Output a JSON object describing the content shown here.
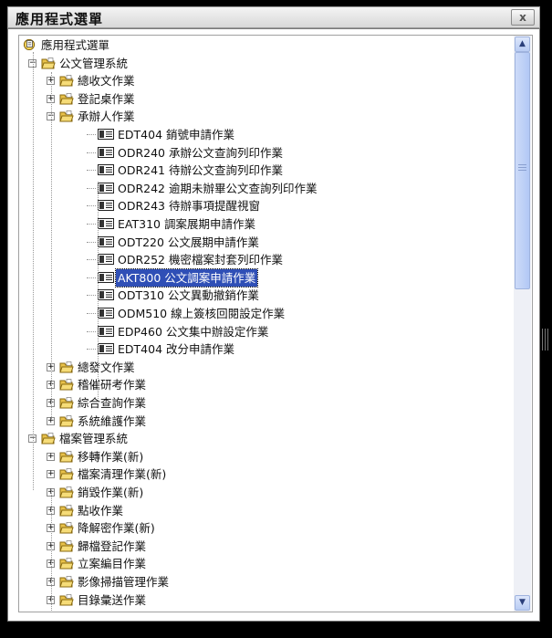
{
  "window": {
    "title": "應用程式選單",
    "close_label": "x"
  },
  "tree": {
    "root_label": "應用程式選單",
    "nodes": [
      {
        "label": "公文管理系統",
        "level": 1,
        "type": "folder",
        "expanded": true
      },
      {
        "label": "總收文作業",
        "level": 2,
        "type": "folder",
        "expanded": false
      },
      {
        "label": "登記桌作業",
        "level": 2,
        "type": "folder",
        "expanded": false
      },
      {
        "label": "承辦人作業",
        "level": 2,
        "type": "folder",
        "expanded": true
      },
      {
        "label": "EDT404 銷號申請作業",
        "level": 3,
        "type": "doc"
      },
      {
        "label": "ODR240 承辦公文查詢列印作業",
        "level": 3,
        "type": "doc"
      },
      {
        "label": "ODR241 待辦公文查詢列印作業",
        "level": 3,
        "type": "doc"
      },
      {
        "label": "ODR242 逾期未辦畢公文查詢列印作業",
        "level": 3,
        "type": "doc"
      },
      {
        "label": "ODR243 待辦事項提醒視窗",
        "level": 3,
        "type": "doc"
      },
      {
        "label": "EAT310 調案展期申請作業",
        "level": 3,
        "type": "doc"
      },
      {
        "label": "ODT220 公文展期申請作業",
        "level": 3,
        "type": "doc"
      },
      {
        "label": "ODR252 機密檔案封套列印作業",
        "level": 3,
        "type": "doc"
      },
      {
        "label": "AKT800 公文調案申請作業",
        "level": 3,
        "type": "doc",
        "selected": true
      },
      {
        "label": "ODT310 公文異動撤銷作業",
        "level": 3,
        "type": "doc"
      },
      {
        "label": "ODM510 線上簽核回閱設定作業",
        "level": 3,
        "type": "doc"
      },
      {
        "label": "EDP460 公文集中辦設定作業",
        "level": 3,
        "type": "doc"
      },
      {
        "label": "EDT404 改分申請作業",
        "level": 3,
        "type": "doc"
      },
      {
        "label": "總發文作業",
        "level": 2,
        "type": "folder",
        "expanded": false
      },
      {
        "label": "稽催研考作業",
        "level": 2,
        "type": "folder",
        "expanded": false
      },
      {
        "label": "綜合查詢作業",
        "level": 2,
        "type": "folder",
        "expanded": false
      },
      {
        "label": "系統維護作業",
        "level": 2,
        "type": "folder",
        "expanded": false
      },
      {
        "label": "檔案管理系統",
        "level": 1,
        "type": "folder",
        "expanded": true
      },
      {
        "label": "移轉作業(新)",
        "level": 2,
        "type": "folder",
        "expanded": false
      },
      {
        "label": "檔案清理作業(新)",
        "level": 2,
        "type": "folder",
        "expanded": false
      },
      {
        "label": "銷毀作業(新)",
        "level": 2,
        "type": "folder",
        "expanded": false
      },
      {
        "label": "點收作業",
        "level": 2,
        "type": "folder",
        "expanded": false
      },
      {
        "label": "降解密作業(新)",
        "level": 2,
        "type": "folder",
        "expanded": false
      },
      {
        "label": "歸檔登記作業",
        "level": 2,
        "type": "folder",
        "expanded": false
      },
      {
        "label": "立案編目作業",
        "level": 2,
        "type": "folder",
        "expanded": false
      },
      {
        "label": "影像掃描管理作業",
        "level": 2,
        "type": "folder",
        "expanded": false
      },
      {
        "label": "目錄彙送作業",
        "level": 2,
        "type": "folder",
        "expanded": false
      }
    ]
  },
  "scrollbar": {
    "up_icon": "▲",
    "down_icon": "▼"
  },
  "colors": {
    "selection": "#2f4fb6",
    "folder": "#e8c14a",
    "background": "#ffffff"
  }
}
